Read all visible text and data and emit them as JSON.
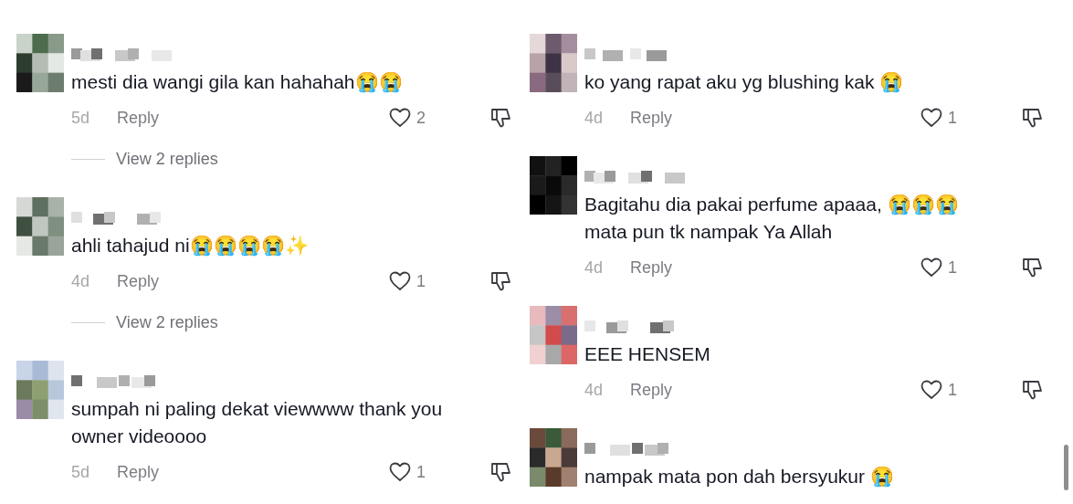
{
  "columns": [
    {
      "comments": [
        {
          "lines": [
            "mesti dia wangi gila kan hahahah😭😭"
          ],
          "age": "5d",
          "reply": "Reply",
          "likes": "2",
          "view_replies": "View 2 replies"
        },
        {
          "lines": [
            "ahli tahajud ni😭😭😭😭✨"
          ],
          "age": "4d",
          "reply": "Reply",
          "likes": "1",
          "view_replies": "View 2 replies"
        },
        {
          "lines": [
            "sumpah ni paling dekat viewwww thank you",
            "owner videoooo"
          ],
          "age": "5d",
          "reply": "Reply",
          "likes": "1"
        }
      ]
    },
    {
      "comments": [
        {
          "lines": [
            "ko yang rapat aku yg blushing kak 😭"
          ],
          "age": "4d",
          "reply": "Reply",
          "likes": "1"
        },
        {
          "lines": [
            "Bagitahu dia pakai perfume apaaa, 😭😭😭",
            "mata pun tk nampak Ya Allah"
          ],
          "age": "4d",
          "reply": "Reply",
          "likes": "1"
        },
        {
          "lines": [
            "EEE HENSEM"
          ],
          "age": "4d",
          "reply": "Reply",
          "likes": "1"
        },
        {
          "lines": [
            "nampak mata pon dah bersyukur 😭"
          ]
        }
      ]
    }
  ]
}
